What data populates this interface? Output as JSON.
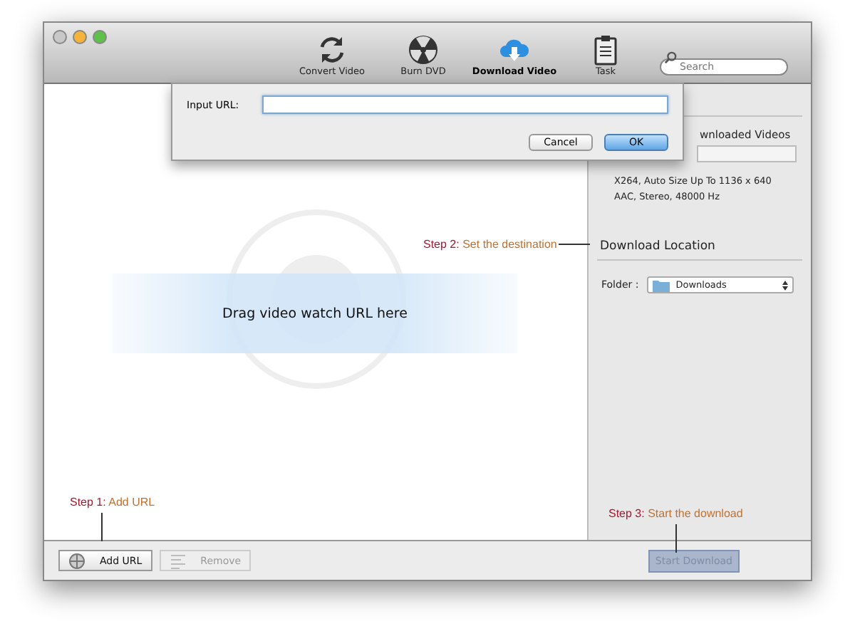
{
  "toolbar": {
    "buttons": [
      {
        "label": "Convert Video",
        "kind": "convert",
        "selected": false
      },
      {
        "label": "Burn DVD",
        "kind": "burn",
        "selected": false
      },
      {
        "label": "Download Video",
        "kind": "download",
        "selected": true
      },
      {
        "label": "Task",
        "kind": "task",
        "selected": false
      }
    ],
    "search": {
      "placeholder": "Search"
    }
  },
  "dialog": {
    "label": "Input URL:",
    "buttons": [
      {
        "label": "Cancel",
        "default": false
      },
      {
        "label": "OK",
        "default": true
      }
    ]
  },
  "drop_zone": {
    "text": "Drag video watch URL here"
  },
  "right_panel": {
    "partial_heading": "wnloaded Videos",
    "spec_lines": [
      "X264, Auto Size Up To 1136 x 640",
      "AAC, Stereo, 48000 Hz"
    ],
    "location_heading": "Download Location",
    "folder_label": "Folder :",
    "folder_value": "Downloads"
  },
  "annotations": [
    {
      "step": "Step 1:",
      "text": "Add URL"
    },
    {
      "step": "Step 2:",
      "text": "Set the destination"
    },
    {
      "step": "Step 3:",
      "text": "Start the download"
    }
  ],
  "bottom_bar": {
    "buttons": [
      {
        "label": "Add URL",
        "disabled": false,
        "kind": "add"
      },
      {
        "label": "Remove",
        "disabled": true,
        "kind": "remove"
      }
    ],
    "start": {
      "label": "Start Download",
      "disabled": true
    }
  }
}
